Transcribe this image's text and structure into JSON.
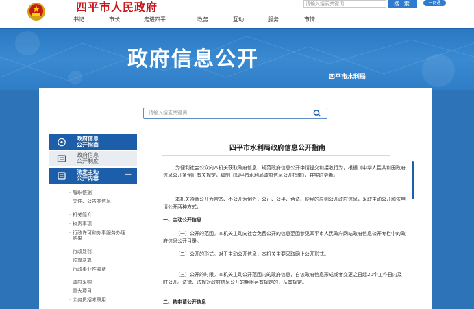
{
  "header": {
    "site_title": "四平市人民政府",
    "search_placeholder": "请输入搜索关键词",
    "search_button": "搜 索",
    "one_network": "一网通"
  },
  "nav": [
    "书记",
    "市长",
    "走进四平",
    "政务",
    "互动",
    "服务",
    "市情"
  ],
  "banner": {
    "title": "政府信息公开",
    "subtitle": "四平市水利局"
  },
  "search": {
    "placeholder": "请输入搜索关键词"
  },
  "sidebar": {
    "tabs": [
      {
        "line1": "政府信息",
        "line2": "公开指南"
      },
      {
        "line1": "政府信息",
        "line2": "公开制度"
      },
      {
        "line1": "法定主动",
        "line2": "公开内容",
        "toggle": "—"
      }
    ],
    "items": [
      "履职依据",
      "文件、公告类信息",
      "机关简介",
      "权责事项",
      "行政许可和办事服务办理结果",
      "行政处罚",
      "预算决算",
      "行政事业性收费",
      "政府采购",
      "重大项目",
      "公务员招考录用"
    ]
  },
  "article": {
    "title": "四平市水利局政府信息公开指南",
    "paragraphs": [
      {
        "type": "text",
        "text": "为便利社会公众向本机关获取政府信息，规范政府信息公开申请提交和接收行为，根据《中华人民共和国政府信息公开条例》有关规定，编制《四平市水利局政府信息公开指南》，并实时更新。"
      },
      {
        "type": "text",
        "text": "本机关遵循公开为常态、不公开为例外，公正、公平、合法、便民的原则公开政府信息，采取主动公开和依申请公开两种方式。"
      },
      {
        "type": "head",
        "text": "一、主动公开信息"
      },
      {
        "type": "text",
        "text": "（一）公开的范围。本机关主动向社会免费公开的信息范围参见四平市人民政府网站政府信息公开专栏中的政府信息公开目录。"
      },
      {
        "type": "text",
        "text": "（二）公开的形式。对于主动公开信息，本机关主要采取网上公开形式。"
      },
      {
        "type": "text",
        "text": "（三）公开的时限。本机关主动公开范围内的政府信息，自该政府信息形成或者变更之日起20个工作日内及时公开。法律、法规对政府信息公开的期限另有规定的，从其规定。"
      },
      {
        "type": "head",
        "text": "二、依申请公开信息"
      }
    ]
  },
  "colors": {
    "brand_red": "#c8161d",
    "primary_blue": "#1c5ea9",
    "banner_blue": "#2d73b8"
  }
}
